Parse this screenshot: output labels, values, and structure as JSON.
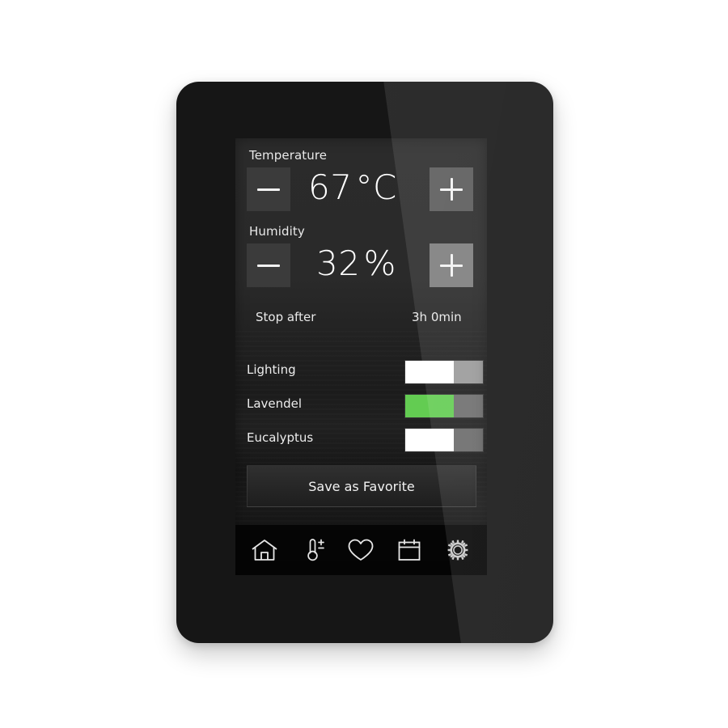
{
  "device": {
    "name": "wall-control-panel",
    "bezel_color": "#161616"
  },
  "screen": {
    "temperature": {
      "label": "Temperature",
      "value": "67",
      "unit": "°C",
      "minus_glyph": "minus-icon",
      "plus_glyph": "plus-icon"
    },
    "humidity": {
      "label": "Humidity",
      "value": "32",
      "unit": "%",
      "minus_glyph": "minus-icon",
      "plus_glyph": "plus-icon"
    },
    "stop_after": {
      "label": "Stop after",
      "value": "3h 0min"
    },
    "toggles": [
      {
        "label": "Lighting",
        "state": "on",
        "on_color": "#ffffff",
        "off_color": "#9a9a9a",
        "fill_percent": 62
      },
      {
        "label": "Lavendel",
        "state": "on",
        "on_color": "#63cc52",
        "off_color": "#6e6e6e",
        "fill_percent": 62
      },
      {
        "label": "Eucalyptus",
        "state": "on",
        "on_color": "#ffffff",
        "off_color": "#6a6a6a",
        "fill_percent": 62
      }
    ],
    "save_button": {
      "label": "Save as Favorite"
    },
    "nav": [
      {
        "name": "home",
        "icon": "home-icon"
      },
      {
        "name": "climate",
        "icon": "thermometer-plus-minus-icon"
      },
      {
        "name": "favorites",
        "icon": "heart-icon"
      },
      {
        "name": "schedule",
        "icon": "calendar-icon"
      },
      {
        "name": "settings",
        "icon": "gear-icon"
      }
    ]
  },
  "colors": {
    "accent_green": "#63cc52",
    "screen_text": "#ededed",
    "button_dark": "#3b3b3b",
    "button_light": "#7d7d7d"
  }
}
